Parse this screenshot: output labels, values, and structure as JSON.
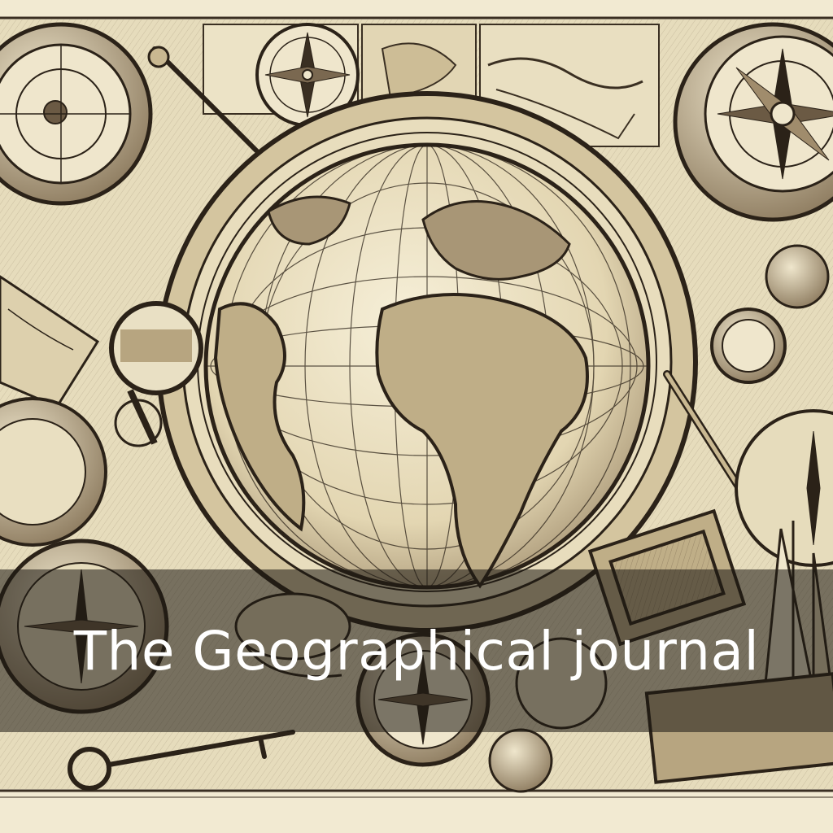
{
  "title": "The Geographical journal",
  "colors": {
    "paper": "#efe6c9",
    "paper_dark": "#d9ccaa",
    "ink": "#2b2218",
    "ink_soft": "#5a4a36",
    "band": "#1c1812"
  },
  "icons": [
    "globe-icon",
    "compass-rose-icon",
    "magnifying-glass-icon",
    "pocket-compass-icon",
    "quill-pen-icon",
    "sailing-ship-icon",
    "key-icon",
    "scroll-map-icon"
  ]
}
